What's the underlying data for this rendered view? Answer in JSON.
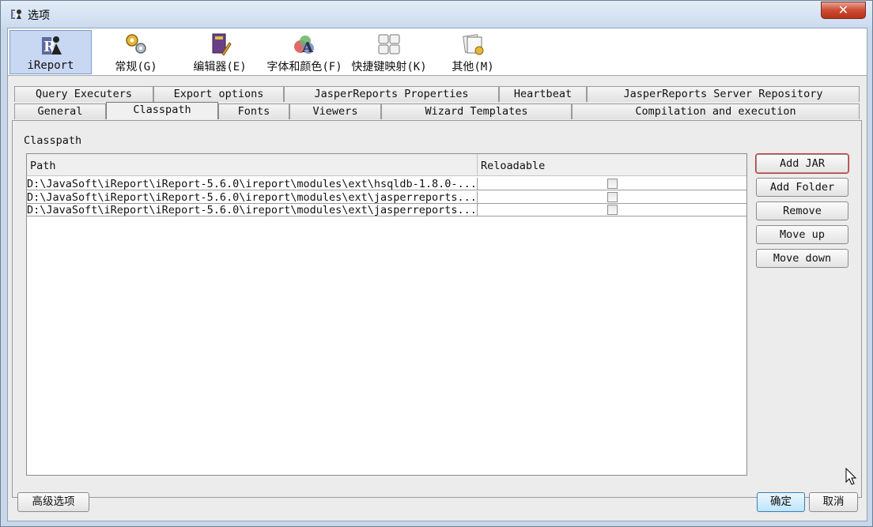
{
  "window": {
    "title": "选项",
    "close_label": "✕"
  },
  "toolbar": {
    "items": [
      {
        "label": "iReport",
        "icon": "ireport-icon",
        "selected": true
      },
      {
        "label": "常规(G)",
        "icon": "gears-icon",
        "selected": false
      },
      {
        "label": "编辑器(E)",
        "icon": "book-pencil-icon",
        "selected": false
      },
      {
        "label": "字体和颜色(F)",
        "icon": "font-colors-icon",
        "selected": false
      },
      {
        "label": "快捷键映射(K)",
        "icon": "keyboard-icon",
        "selected": false
      },
      {
        "label": "其他(M)",
        "icon": "misc-icon",
        "selected": false
      }
    ]
  },
  "tabs": {
    "row1": [
      "Query Executers",
      "Export options",
      "JasperReports Properties",
      "Heartbeat",
      "JasperReports Server Repository"
    ],
    "row2": [
      "General",
      "Classpath",
      "Fonts",
      "Viewers",
      "Wizard Templates",
      "Compilation and execution"
    ],
    "active": "Classpath"
  },
  "classpath": {
    "section_label": "Classpath",
    "columns": [
      "Path",
      "Reloadable"
    ],
    "rows": [
      {
        "path": "D:\\JavaSoft\\iReport\\iReport-5.6.0\\ireport\\modules\\ext\\hsqldb-1.8.0-...",
        "reloadable": false
      },
      {
        "path": "D:\\JavaSoft\\iReport\\iReport-5.6.0\\ireport\\modules\\ext\\jasperreports...",
        "reloadable": false
      },
      {
        "path": "D:\\JavaSoft\\iReport\\iReport-5.6.0\\ireport\\modules\\ext\\jasperreports...",
        "reloadable": false
      }
    ],
    "buttons": {
      "add_jar": "Add JAR",
      "add_folder": "Add Folder",
      "remove": "Remove",
      "move_up": "Move up",
      "move_down": "Move down"
    }
  },
  "footer": {
    "advanced": "高级选项",
    "ok": "确定",
    "cancel": "取消"
  },
  "colors": {
    "selection": "#c8d7f2",
    "highlight": "#d93030",
    "close": "#cc4b33"
  }
}
